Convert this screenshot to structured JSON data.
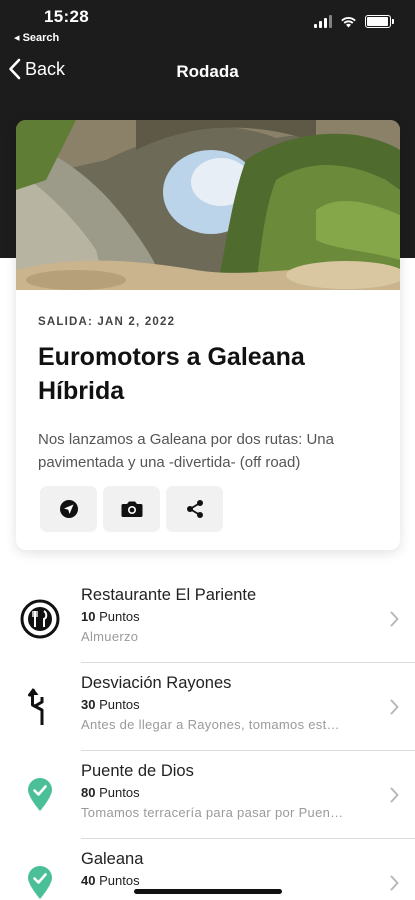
{
  "status_bar": {
    "time": "15:28",
    "back_app": "◂ Search",
    "battery_level": 0.95
  },
  "nav": {
    "back_label": "Back",
    "title": "Rodada"
  },
  "card": {
    "salida": "SALIDA: JAN 2, 2022",
    "title": "Euromotors a Galeana Híbrida",
    "description": "Nos lanzamos a Galeana por dos rutas: Una pavimentada y una -divertida- (off road)",
    "actions": [
      "navigation-arrow-icon",
      "camera-icon",
      "share-icon"
    ]
  },
  "list": {
    "items": [
      {
        "icon": "restaurant-icon",
        "name": "Restaurante El Pariente",
        "points": "10",
        "points_label": "Puntos",
        "desc": "Almuerzo"
      },
      {
        "icon": "turn-arrow-icon",
        "name": "Desviación Rayones",
        "points": "30",
        "points_label": "Puntos",
        "desc": "Antes de llegar a Rayones, tomamos est…"
      },
      {
        "icon": "map-pin-check-icon",
        "name": "Puente de Dios",
        "points": "80",
        "points_label": "Puntos",
        "desc": "Tomamos terracería para pasar por Puen…"
      },
      {
        "icon": "map-pin-check-icon",
        "name": "Galeana",
        "points": "40",
        "points_label": "Puntos",
        "desc": ""
      }
    ]
  },
  "colors": {
    "dark_header": "#1c1c1c",
    "pin_green": "#4bbf97",
    "accent_text": "#111111"
  }
}
